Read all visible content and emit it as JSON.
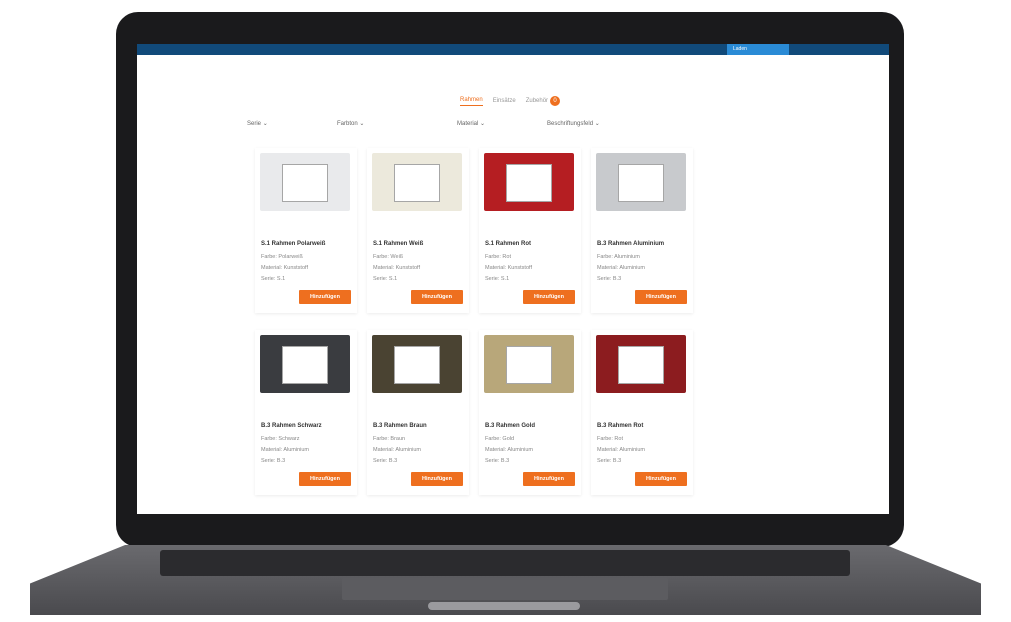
{
  "topbar": {
    "button_label": "Laden"
  },
  "tabs": [
    {
      "label": "Rahmen",
      "active": true
    },
    {
      "label": "Einsätze",
      "active": false
    },
    {
      "label": "Zubehör",
      "active": false
    }
  ],
  "tab_badge": "0",
  "filters": [
    {
      "label": "Serie"
    },
    {
      "label": "Farbton"
    },
    {
      "label": "Material"
    },
    {
      "label": "Beschriftungsfeld"
    }
  ],
  "add_label": "Hinzufügen",
  "products": [
    {
      "name": "S.1 Rahmen Polarweiß",
      "farbe": "Farbe: Polarweiß",
      "material": "Material: Kunststoff",
      "serie": "Serie: S.1",
      "frame_color": "#e9eaec",
      "inner_color": "#ffffff"
    },
    {
      "name": "S.1 Rahmen Weiß",
      "farbe": "Farbe: Weiß",
      "material": "Material: Kunststoff",
      "serie": "Serie: S.1",
      "frame_color": "#ece9dc",
      "inner_color": "#ffffff"
    },
    {
      "name": "S.1 Rahmen Rot",
      "farbe": "Farbe: Rot",
      "material": "Material: Kunststoff",
      "serie": "Serie: S.1",
      "frame_color": "#b51e22",
      "inner_color": "#ffffff"
    },
    {
      "name": "B.3 Rahmen Aluminium",
      "farbe": "Farbe: Aluminium",
      "material": "Material: Aluminium",
      "serie": "Serie: B.3",
      "frame_color": "#c8cacd",
      "inner_color": "#ffffff"
    },
    {
      "name": "B.3 Rahmen Schwarz",
      "farbe": "Farbe: Schwarz",
      "material": "Material: Aluminium",
      "serie": "Serie: B.3",
      "frame_color": "#3a3c40",
      "inner_color": "#ffffff"
    },
    {
      "name": "B.3 Rahmen Braun",
      "farbe": "Farbe: Braun",
      "material": "Material: Aluminium",
      "serie": "Serie: B.3",
      "frame_color": "#4a4332",
      "inner_color": "#ffffff"
    },
    {
      "name": "B.3 Rahmen Gold",
      "farbe": "Farbe: Gold",
      "material": "Material: Aluminium",
      "serie": "Serie: B.3",
      "frame_color": "#b8a77a",
      "inner_color": "#ffffff"
    },
    {
      "name": "B.3 Rahmen Rot",
      "farbe": "Farbe: Rot",
      "material": "Material: Aluminium",
      "serie": "Serie: B.3",
      "frame_color": "#8c1c1f",
      "inner_color": "#ffffff"
    }
  ]
}
